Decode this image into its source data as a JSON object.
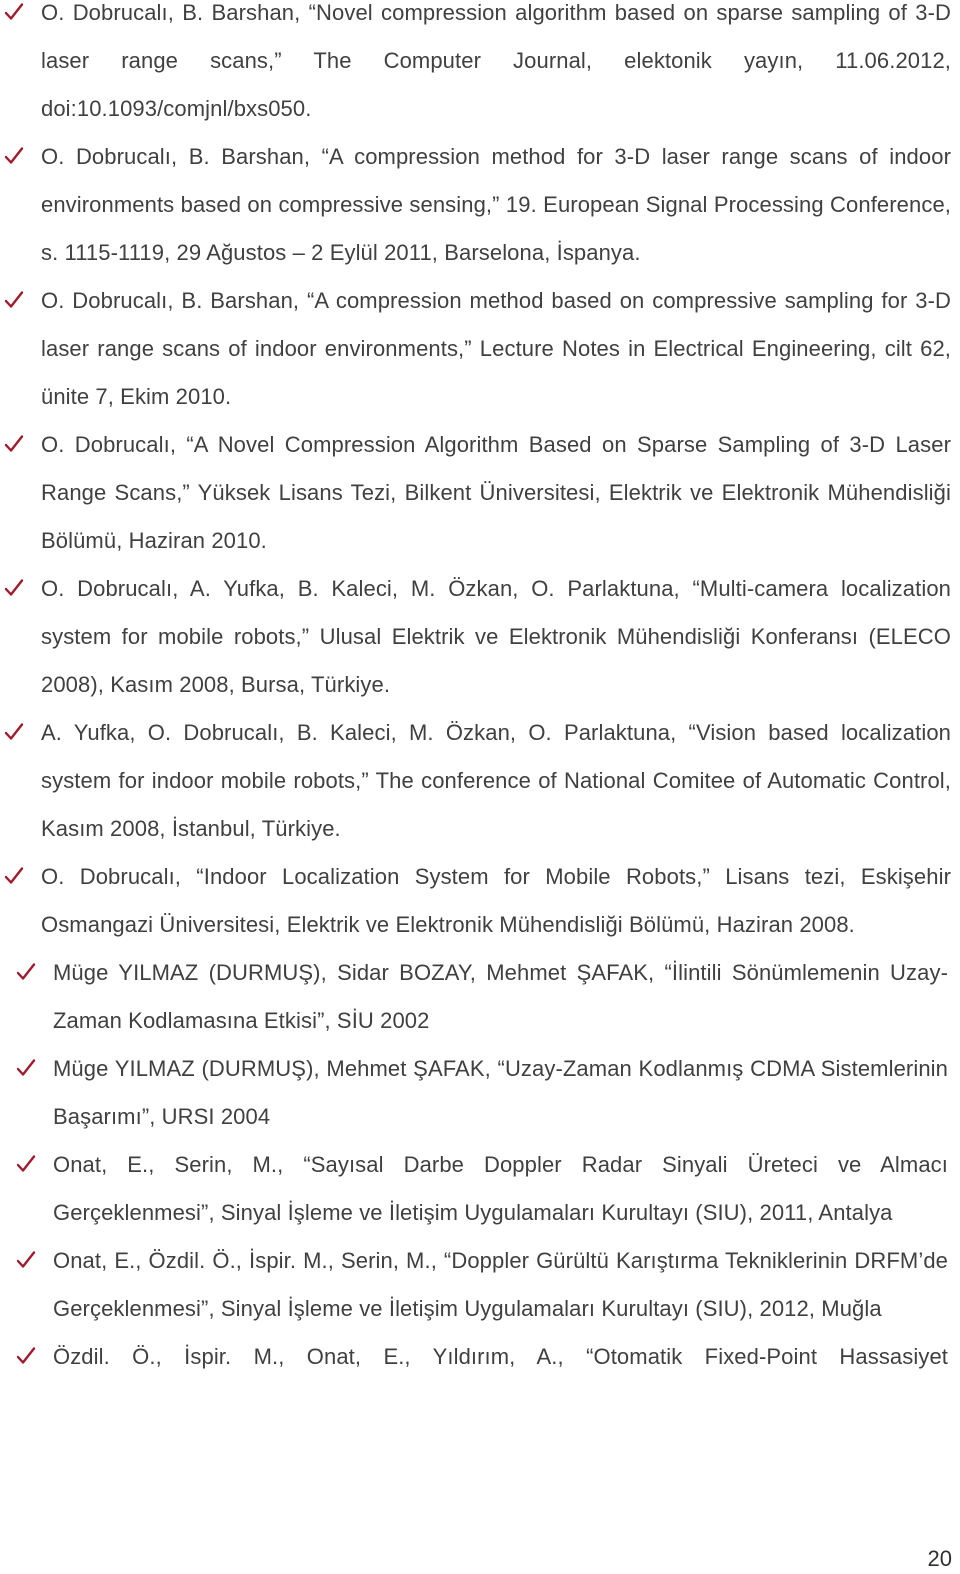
{
  "document": {
    "page_number": "20",
    "bullet_icon": "checkmark-icon",
    "bullet_color": "#a01c2a",
    "text_color": "#404040",
    "references": [
      {
        "text": "O. Dobrucalı, B. Barshan, “Novel compression algorithm based on sparse sampling of 3-D laser range scans,” The Computer Journal, elektonik yayın, 11.06.2012, doi:10.1093/comjnl/bxs050.",
        "group": "a"
      },
      {
        "text": "O. Dobrucalı, B. Barshan, “A compression method for 3-D laser range scans of indoor environments based on compressive sensing,” 19. European Signal Processing Conference, s. 1115-1119, 29 Ağustos – 2 Eylül 2011, Barselona, İspanya.",
        "group": "a"
      },
      {
        "text": "O. Dobrucalı, B. Barshan, “A compression method based on compressive sampling for 3-D laser range scans of indoor environments,” Lecture Notes in Electrical Engineering, cilt 62, ünite 7, Ekim 2010.",
        "group": "a"
      },
      {
        "text": "O. Dobrucalı, “A Novel Compression Algorithm Based on Sparse Sampling of 3-D Laser Range Scans,” Yüksek Lisans Tezi, Bilkent Üniversitesi, Elektrik ve Elektronik Mühendisliği Bölümü, Haziran 2010.",
        "group": "a"
      },
      {
        "text": "O. Dobrucalı, A. Yufka, B. Kaleci, M. Özkan, O. Parlaktuna, “Multi-camera localization system for mobile robots,” Ulusal Elektrik ve Elektronik Mühendisliği Konferansı (ELECO 2008), Kasım 2008, Bursa, Türkiye.",
        "group": "a"
      },
      {
        "text": "A. Yufka, O. Dobrucalı, B. Kaleci, M. Özkan, O. Parlaktuna, “Vision based localization system for indoor mobile robots,” The conference of National Comitee of Automatic Control, Kasım 2008, İstanbul, Türkiye.",
        "group": "a"
      },
      {
        "text": "O. Dobrucalı, “Indoor Localization System for Mobile Robots,” Lisans tezi, Eskişehir Osmangazi Üniversitesi, Elektrik ve Elektronik Mühendisliği Bölümü, Haziran 2008.",
        "group": "a"
      },
      {
        "text": "Müge YILMAZ (DURMUŞ), Sidar BOZAY, Mehmet ŞAFAK, “İlintili Sönümlemenin Uzay-Zaman Kodlamasına Etkisi”, SİU 2002",
        "group": "b"
      },
      {
        "text": "Müge YILMAZ (DURMUŞ), Mehmet ŞAFAK, “Uzay-Zaman Kodlanmış CDMA Sistemlerinin Başarımı”, URSI 2004",
        "group": "b"
      },
      {
        "text": "Onat, E., Serin, M., “Sayısal Darbe Doppler Radar Sinyali Üreteci ve Almacı Gerçeklenmesi”, Sinyal İşleme ve İletişim Uygulamaları Kurultayı (SIU), 2011, Antalya",
        "group": "b"
      },
      {
        "text": "Onat, E., Özdil. Ö., İspir. M., Serin, M.,  “Doppler Gürültü Karıştırma Tekniklerinin DRFM’de Gerçeklenmesi”, Sinyal İşleme ve İletişim Uygulamaları Kurultayı (SIU), 2012, Muğla",
        "group": "b"
      },
      {
        "text": "Özdil. Ö., İspir. M., Onat, E., Yıldırım, A., “Otomatik Fixed-Point Hassasiyet",
        "group": "b"
      }
    ]
  }
}
